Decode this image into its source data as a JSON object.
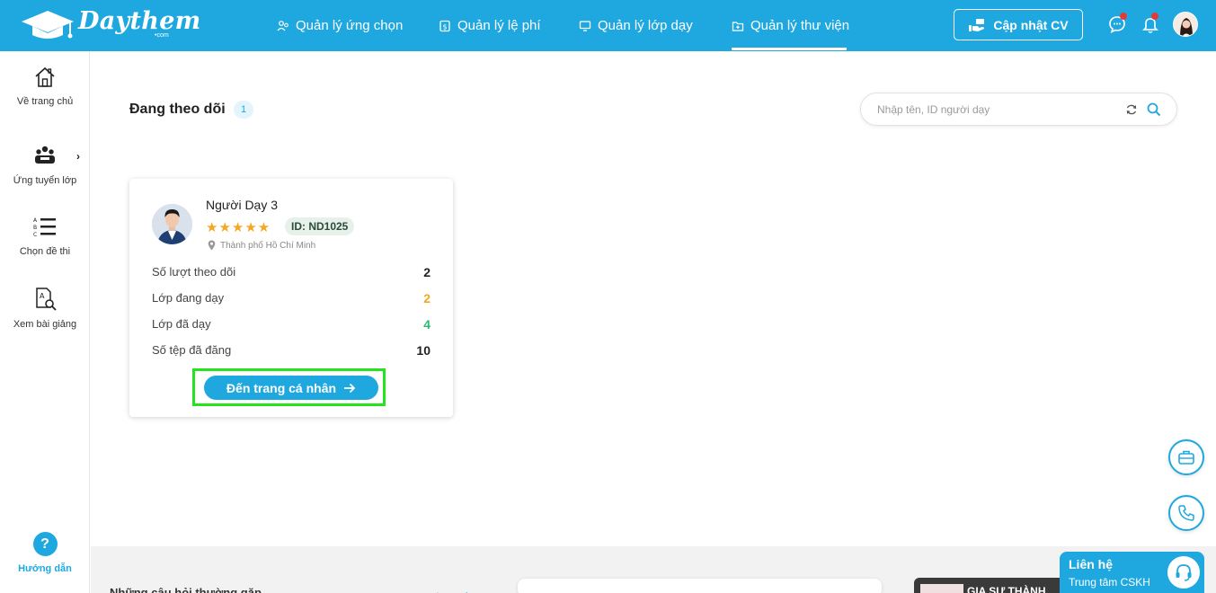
{
  "header": {
    "logo_text": "Daythem",
    "logo_sub": "•com",
    "nav": [
      {
        "label": "Quản lý ứng chọn",
        "icon": "users-icon"
      },
      {
        "label": "Quản lý lệ phí",
        "icon": "fee-icon"
      },
      {
        "label": "Quản lý lớp dạy",
        "icon": "monitor-icon"
      },
      {
        "label": "Quản lý thư viện",
        "icon": "folder-icon"
      }
    ],
    "active_nav": "Quản lý thư viện",
    "cv_button": "Cập nhật CV"
  },
  "sidebar": {
    "items": [
      {
        "label": "Về trang chủ",
        "icon": "home-icon"
      },
      {
        "label": "Ứng tuyển lớp",
        "icon": "group-icon"
      },
      {
        "label": "Chọn đề thi",
        "icon": "list-abc-icon"
      },
      {
        "label": "Xem bài giảng",
        "icon": "document-search-icon"
      }
    ],
    "expand_chevron": "›",
    "help_symbol": "?",
    "help_label": "Hướng dẫn"
  },
  "main": {
    "title": "Đang theo dõi",
    "count": "1",
    "search_placeholder": "Nhập tên, ID người dạy"
  },
  "card": {
    "name": "Người Dạy 3",
    "stars": "★★★★★",
    "id_badge": "ID: ND1025",
    "location": "Thành phố Hồ Chí Minh",
    "stats": [
      {
        "label": "Số lượt theo dõi",
        "value": "2",
        "color": "#222222"
      },
      {
        "label": "Lớp đang dạy",
        "value": "2",
        "color": "#f5a623"
      },
      {
        "label": "Lớp đã dạy",
        "value": "4",
        "color": "#2eb872"
      },
      {
        "label": "Số tệp đã đăng",
        "value": "10",
        "color": "#222222"
      }
    ],
    "profile_button": "Đến trang cá nhân"
  },
  "footer": {
    "section_title": "Những câu hỏi thường gặp",
    "dark_card_text": "GIA SƯ THÀNH",
    "pager_prev": "‹",
    "pager_next": "›"
  },
  "contact": {
    "title": "Liên hệ",
    "subtitle": "Trung tâm CSKH"
  },
  "colors": {
    "primary": "#1fa8df",
    "highlight_frame": "#27e31e",
    "star": "#f5a623",
    "notification": "#e53935"
  }
}
